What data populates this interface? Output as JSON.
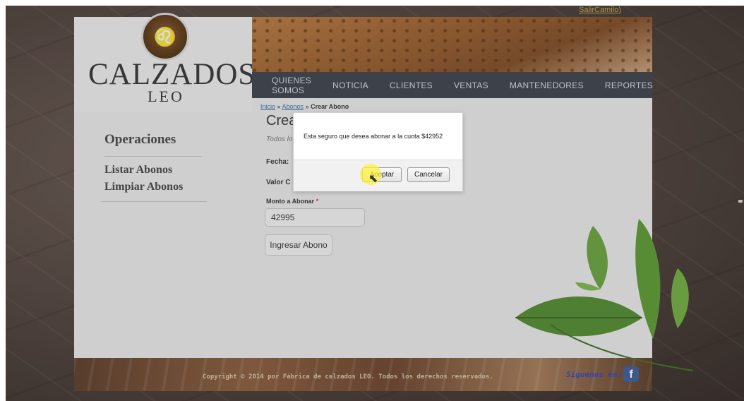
{
  "header": {
    "user_link": "SalirCamilo)",
    "logo_title": "CALZADOS",
    "logo_subtitle": "LEO"
  },
  "nav": {
    "items": [
      {
        "label": "QUIENES SOMOS"
      },
      {
        "label": "NOTICIA"
      },
      {
        "label": "CLIENTES"
      },
      {
        "label": "VENTAS"
      },
      {
        "label": "MANTENEDORES"
      },
      {
        "label": "REPORTES"
      }
    ]
  },
  "breadcrumb": {
    "home": "Inicio",
    "sep1": " » ",
    "section": "Abonos",
    "sep2": " » ",
    "current": "Crear Abono"
  },
  "main": {
    "title": "Crea",
    "required_note": "Todos lo",
    "fecha_label": "Fecha:",
    "valor_label": "Valor C",
    "monto_label": "Monto a Abonar",
    "monto_required": "*",
    "monto_value": "42995",
    "submit_label": "Ingresar Abono"
  },
  "sidebar": {
    "title": "Operaciones",
    "links": [
      {
        "label": "Listar Abonos"
      },
      {
        "label": "Limpiar Abonos"
      }
    ]
  },
  "footer": {
    "copyright": "Copyright © 2014 por Fábrica de calzados LEO. Todos los derechos reservados.",
    "follow": "Siguenos en:",
    "fb_letter": "f"
  },
  "dialog": {
    "message": "Esta seguro que desea abonar a la cuota $42952",
    "accept_label": "Aceptar",
    "cancel_label": "Cancelar"
  },
  "colors": {
    "navbar": "#3a3f4a",
    "link": "#3a6ea5",
    "facebook": "#3b5998"
  }
}
